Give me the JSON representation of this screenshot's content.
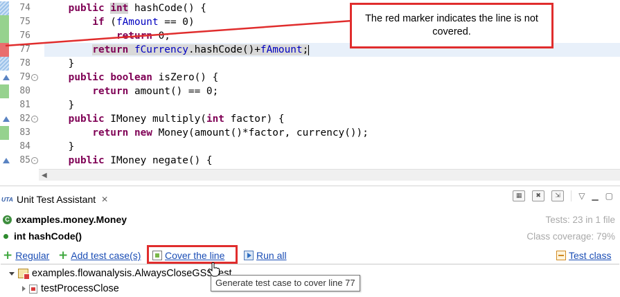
{
  "editor": {
    "lines": [
      {
        "num": "74",
        "coverage": "part",
        "fold": "",
        "segments": [
          {
            "t": "    "
          },
          {
            "t": "public",
            "c": "kw"
          },
          {
            "t": " "
          },
          {
            "t": "int",
            "c": "kw mark-int"
          },
          {
            "t": " hashCode() {"
          }
        ]
      },
      {
        "num": "75",
        "coverage": "green",
        "fold": "",
        "segments": [
          {
            "t": "        "
          },
          {
            "t": "if",
            "c": "kw"
          },
          {
            "t": " ("
          },
          {
            "t": "fAmount",
            "c": "fld"
          },
          {
            "t": " == 0)"
          }
        ]
      },
      {
        "num": "76",
        "coverage": "green",
        "fold": "",
        "segments": [
          {
            "t": "            "
          },
          {
            "t": "return",
            "c": "kw"
          },
          {
            "t": " 0;"
          }
        ]
      },
      {
        "num": "77",
        "coverage": "red",
        "fold": "",
        "highlight": true,
        "segments": [
          {
            "t": "        "
          },
          {
            "t": "return",
            "c": "kw sel"
          },
          {
            "t": " ",
            "c": "sel"
          },
          {
            "t": "fCurrency",
            "c": "fld sel"
          },
          {
            "t": ".hashCode()+",
            "c": "sel"
          },
          {
            "t": "fAmount",
            "c": "fld sel"
          },
          {
            "t": ";",
            "c": "sel"
          },
          {
            "t": "",
            "c": "caret"
          }
        ]
      },
      {
        "num": "78",
        "coverage": "part",
        "fold": "",
        "segments": [
          {
            "t": "    }"
          }
        ]
      },
      {
        "num": "79",
        "coverage": "",
        "fold": "⊖",
        "override": true,
        "segments": [
          {
            "t": "    "
          },
          {
            "t": "public",
            "c": "kw"
          },
          {
            "t": " "
          },
          {
            "t": "boolean",
            "c": "kw"
          },
          {
            "t": " isZero() {"
          }
        ]
      },
      {
        "num": "80",
        "coverage": "green",
        "fold": "",
        "segments": [
          {
            "t": "        "
          },
          {
            "t": "return",
            "c": "kw"
          },
          {
            "t": " amount() == 0;"
          }
        ]
      },
      {
        "num": "81",
        "coverage": "",
        "fold": "",
        "segments": [
          {
            "t": "    }"
          }
        ]
      },
      {
        "num": "82",
        "coverage": "",
        "fold": "⊖",
        "override": true,
        "segments": [
          {
            "t": "    "
          },
          {
            "t": "public",
            "c": "kw"
          },
          {
            "t": " IMoney multiply("
          },
          {
            "t": "int",
            "c": "kw"
          },
          {
            "t": " factor) {"
          }
        ]
      },
      {
        "num": "83",
        "coverage": "green",
        "fold": "",
        "segments": [
          {
            "t": "        "
          },
          {
            "t": "return",
            "c": "kw"
          },
          {
            "t": " "
          },
          {
            "t": "new",
            "c": "kw"
          },
          {
            "t": " Money(amount()*factor, currency());"
          }
        ]
      },
      {
        "num": "84",
        "coverage": "",
        "fold": "",
        "segments": [
          {
            "t": "    }"
          }
        ]
      },
      {
        "num": "85",
        "coverage": "",
        "fold": "⊖",
        "override": true,
        "segments": [
          {
            "t": "    "
          },
          {
            "t": "public",
            "c": "kw"
          },
          {
            "t": " IMoney negate() {"
          }
        ]
      }
    ]
  },
  "callout": {
    "text": "The red marker indicates the line is not covered.",
    "border_color": "#e02d2d"
  },
  "panel": {
    "tab_icon_text": "UTA",
    "tab_title": "Unit Test Assistant",
    "tab_close": "✕",
    "toolbar_icons": [
      "layout-icon",
      "remove-all-icon",
      "export-icon",
      "view-menu-icon",
      "minimize-icon",
      "maximize-icon"
    ],
    "class_name": "examples.money.Money",
    "class_icon_letter": "C",
    "method_name": "int hashCode()",
    "tests_stat": "Tests: 23 in 1 file",
    "coverage_stat": "Class coverage: 79%",
    "actions": {
      "regular": "Regular",
      "add_test_case": "Add test case(s)",
      "cover_line": "Cover the line",
      "run_all": "Run all",
      "test_class": "Test class"
    },
    "tree": {
      "root": "examples.flowanalysis.AlwaysCloseGSSTest",
      "child": "testProcessClose"
    },
    "tooltip": "Generate test case to cover line 77"
  }
}
